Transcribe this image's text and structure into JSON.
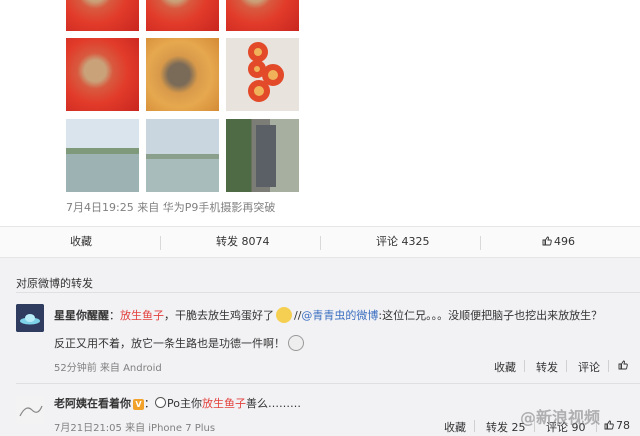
{
  "post": {
    "meta": "7月4日19:25 来自 华为P9手机摄影再突破"
  },
  "actions": {
    "favorite": "收藏",
    "repost": "转发 8074",
    "comment": "评论 4325",
    "like": "496"
  },
  "section_title": "对原微博的转发",
  "comments": [
    {
      "user": "星星你醒醒",
      "colon": "：",
      "mention": "放生鱼子",
      "text1": "，干脆去放生鸡蛋好了",
      "repost_sep": "//",
      "repost_user": "@青青虫的微博",
      "text2": ":这位仁兄。。。没顺便把脑子也挖出来放放生？",
      "text3": "反正又用不着，放它一条生路也是功德一件啊！",
      "time": "52分钟前 来自 Android",
      "favorite": "收藏",
      "repost": "转发",
      "comment": "评论"
    },
    {
      "user": "老阿姨在看着你",
      "colon": "：",
      "badge": "V",
      "text_prefix": "Po主你",
      "mention": "放生鱼子",
      "text_suffix": "善么………",
      "time": "7月21日21:05 来自 iPhone 7 Plus",
      "favorite": "收藏",
      "repost": "转发 25",
      "comment": "评论 90",
      "like": "78"
    }
  ],
  "watermark": "@新浪视频"
}
